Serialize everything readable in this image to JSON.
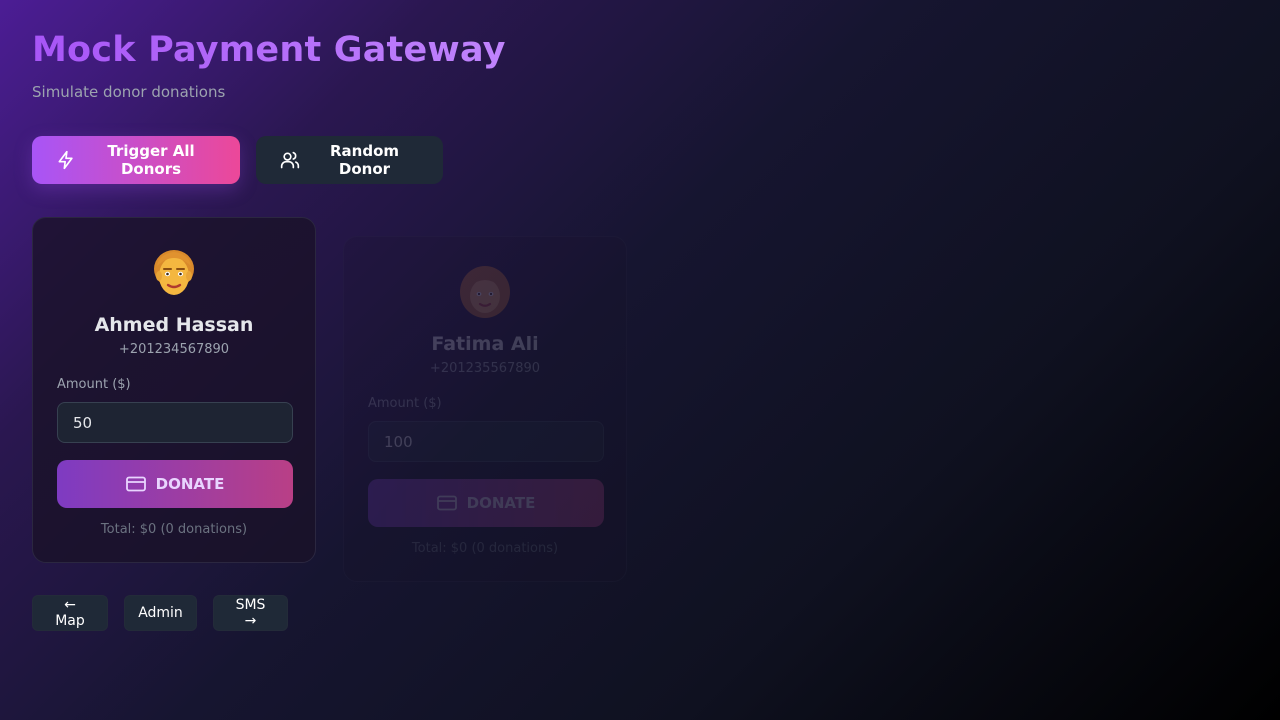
{
  "header": {
    "title": "Mock Payment Gateway",
    "subtitle": "Simulate donor donations"
  },
  "actions": {
    "trigger_all_label": "Trigger All Donors",
    "trigger_all_icon": "lightning-icon",
    "random_donor_label": "Random Donor",
    "random_donor_icon": "users-icon"
  },
  "donors": [
    {
      "name": "Ahmed Hassan",
      "phone": "+201234567890",
      "amount_label": "Amount ($)",
      "amount": "50",
      "donate_label": "DONATE",
      "total": "Total: $0 (0 donations)",
      "avatar": "man-avatar-icon",
      "state": "active"
    },
    {
      "name": "Fatima Ali",
      "phone": "+201235567890",
      "amount_label": "Amount ($)",
      "amount": "100",
      "donate_label": "DONATE",
      "total": "Total: $0 (0 donations)",
      "avatar": "woman-avatar-icon",
      "state": "faded"
    }
  ],
  "nav": {
    "map_label": "← Map",
    "admin_label": "Admin",
    "sms_label": "SMS →"
  },
  "colors": {
    "accent_purple": "#a855f7",
    "accent_pink": "#ec4899",
    "button_dark": "#1f2937"
  }
}
